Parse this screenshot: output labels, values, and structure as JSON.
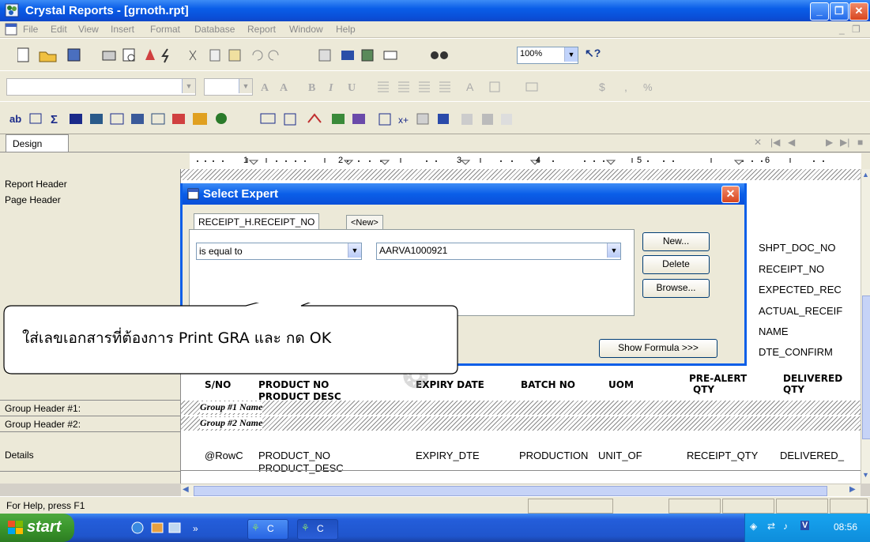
{
  "window": {
    "title": "Crystal Reports - [grnoth.rpt]"
  },
  "menu": [
    "File",
    "Edit",
    "View",
    "Insert",
    "Format",
    "Database",
    "Report",
    "Window",
    "Help"
  ],
  "toolbar": {
    "zoom": "100%"
  },
  "tabs": {
    "design": "Design"
  },
  "ruler": {
    "marks": [
      "1",
      "2",
      "3",
      "4",
      "5",
      "6"
    ]
  },
  "sections": {
    "report_header": "Report Header",
    "page_header": "Page Header",
    "group_header_1": "Group Header #1:",
    "group_header_2": "Group Header #2:",
    "details": "Details"
  },
  "canvas": {
    "page_header_fields": [
      "SHPT_DOC_NO",
      "RECEIPT_NO",
      "EXPECTED_REC",
      "ACTUAL_RECEIF",
      "NAME",
      "DTE_CONFIRM"
    ],
    "column_headers": {
      "sno": "S/NO",
      "product_no": "PRODUCT NO",
      "product_desc": "PRODUCT DESC",
      "expiry": "EXPIRY DATE",
      "batch": "BATCH NO",
      "uom": "UOM",
      "prealert_1": "PRE-ALERT",
      "prealert_2": "QTY",
      "delivered_1": "DELIVERED",
      "delivered_2": "QTY"
    },
    "group1": "Group #1 Name",
    "group2": "Group #2 Name",
    "details": {
      "rowc": "@RowC",
      "product_no": "PRODUCT_NO",
      "product_desc": "PRODUCT_DESC",
      "expiry": "EXPIRY_DTE",
      "production": "PRODUCTION",
      "unit": "UNIT_OF",
      "receipt_qty": "RECEIPT_QTY",
      "delivered": "DELIVERED_"
    }
  },
  "dialog": {
    "title": "Select Expert",
    "tab_field": "RECEIPT_H.RECEIPT_NO",
    "tab_new": "<New>",
    "operator": "is equal to",
    "value": "AARVA1000921",
    "btn_new": "New...",
    "btn_delete": "Delete",
    "btn_browse": "Browse...",
    "btn_formula": "Show Formula >>>"
  },
  "callout": {
    "text": "ใส่เลขเอกสารที่ต้องการ Print GRA และ กด OK"
  },
  "status": {
    "help": "For Help, press F1"
  },
  "taskbar": {
    "start": "start",
    "task1": "C",
    "task2": "C",
    "clock": "08:56"
  },
  "colors": {
    "titlebar": "#0a5ee8",
    "start": "#3a962c",
    "close": "#d8461f"
  }
}
